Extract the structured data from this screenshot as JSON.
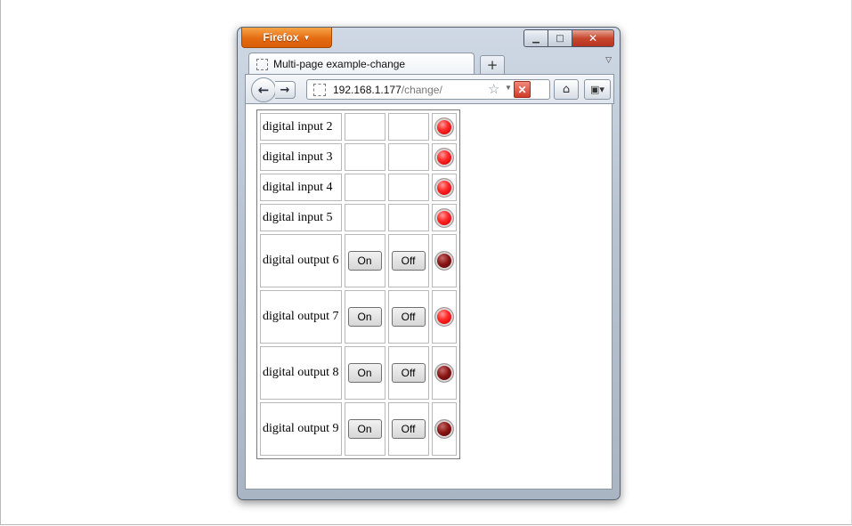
{
  "browser": {
    "menu_label": "Firefox",
    "tab_title": "Multi-page example-change",
    "url_host": "192.168.1.177",
    "url_path": "/change/"
  },
  "rows": [
    {
      "label": "digital input 2",
      "type": "input",
      "led": "on"
    },
    {
      "label": "digital input 3",
      "type": "input",
      "led": "on"
    },
    {
      "label": "digital input 4",
      "type": "input",
      "led": "on"
    },
    {
      "label": "digital input 5",
      "type": "input",
      "led": "on"
    },
    {
      "label": "digital output 6",
      "type": "output",
      "on_label": "On",
      "off_label": "Off",
      "led": "off"
    },
    {
      "label": "digital output 7",
      "type": "output",
      "on_label": "On",
      "off_label": "Off",
      "led": "on"
    },
    {
      "label": "digital output 8",
      "type": "output",
      "on_label": "On",
      "off_label": "Off",
      "led": "off"
    },
    {
      "label": "digital output 9",
      "type": "output",
      "on_label": "On",
      "off_label": "Off",
      "led": "off"
    }
  ],
  "colors": {
    "firefox_orange": "#e56b12",
    "led_on": "#ff2a2a",
    "led_off": "#8a1414"
  }
}
